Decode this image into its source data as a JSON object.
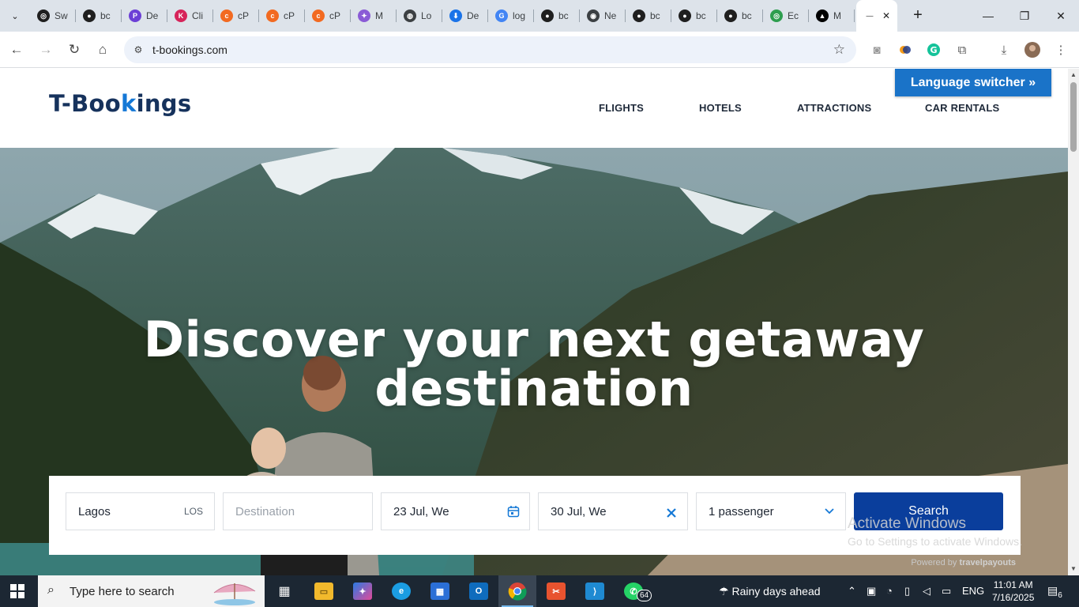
{
  "browser": {
    "tabs": [
      {
        "title": "Sw",
        "icon": "chatgpt-icon",
        "color": "#1f1f1f",
        "glyph": "◎"
      },
      {
        "title": "bc",
        "icon": "github-icon",
        "color": "#1f1f1f",
        "glyph": "●"
      },
      {
        "title": "De",
        "icon": "p-brand-icon",
        "color": "#6c3fd6",
        "glyph": "P"
      },
      {
        "title": "Cli",
        "icon": "k-brand-icon",
        "color": "#d6245a",
        "glyph": "K"
      },
      {
        "title": "cP",
        "icon": "cpanel-icon",
        "color": "#f26a21",
        "glyph": "c"
      },
      {
        "title": "cP",
        "icon": "cpanel-icon",
        "color": "#f26a21",
        "glyph": "c"
      },
      {
        "title": "cP",
        "icon": "cpanel-icon",
        "color": "#f26a21",
        "glyph": "c"
      },
      {
        "title": "M",
        "icon": "copilot-icon",
        "color": "#8a5bd6",
        "glyph": "✦"
      },
      {
        "title": "Lo",
        "icon": "globe-icon",
        "color": "#3c4043",
        "glyph": "◍"
      },
      {
        "title": "De",
        "icon": "download-icon",
        "color": "#1a73e8",
        "glyph": "⬇"
      },
      {
        "title": "log",
        "icon": "google-icon",
        "color": "#4285f4",
        "glyph": "G"
      },
      {
        "title": "bc",
        "icon": "github-icon",
        "color": "#1f1f1f",
        "glyph": "●"
      },
      {
        "title": "Ne",
        "icon": "chrome-icon",
        "color": "#3c4043",
        "glyph": "◉"
      },
      {
        "title": "bc",
        "icon": "github-icon",
        "color": "#1f1f1f",
        "glyph": "●"
      },
      {
        "title": "bc",
        "icon": "github-icon",
        "color": "#1f1f1f",
        "glyph": "●"
      },
      {
        "title": "bc",
        "icon": "github-icon",
        "color": "#1f1f1f",
        "glyph": "●"
      },
      {
        "title": "Ec",
        "icon": "green-circle-icon",
        "color": "#2e9e4f",
        "glyph": "◎"
      },
      {
        "title": "M",
        "icon": "vercel-icon",
        "color": "#000000",
        "glyph": "▲"
      },
      {
        "title": "—",
        "icon": "loading-icon",
        "color": "#777777",
        "glyph": "—",
        "active": true
      }
    ],
    "url": "t-bookings.com"
  },
  "site": {
    "logo_prefix": "T-Boo",
    "logo_dot": "k",
    "logo_suffix": "ings",
    "nav": [
      "FLIGHTS",
      "HOTELS",
      "ATTRACTIONS",
      "CAR RENTALS"
    ],
    "language_button": "Language switcher »",
    "hero_line1": "Discover your next getaway",
    "hero_line2": "destination",
    "search": {
      "origin_value": "Lagos",
      "origin_code": "LOS",
      "destination_placeholder": "Destination",
      "depart_date": "23 Jul, We",
      "return_date": "30 Jul, We",
      "passengers": "1 passenger",
      "button": "Search",
      "powered_prefix": "Powered by",
      "powered_brand": "travelpayouts"
    }
  },
  "watermark": {
    "line1": "Activate Windows",
    "line2": "Go to Settings to activate Windows."
  },
  "taskbar": {
    "search_placeholder": "Type here to search",
    "weather": "Rainy days ahead",
    "language": "ENG",
    "time": "11:01 AM",
    "date": "7/16/2025",
    "whatsapp_badge": "64",
    "notifications": "6"
  },
  "colors": {
    "brand_navy": "#16325c",
    "brand_blue": "#1478d6",
    "search_button": "#0a3e9c",
    "language_button": "#1a73c8"
  }
}
